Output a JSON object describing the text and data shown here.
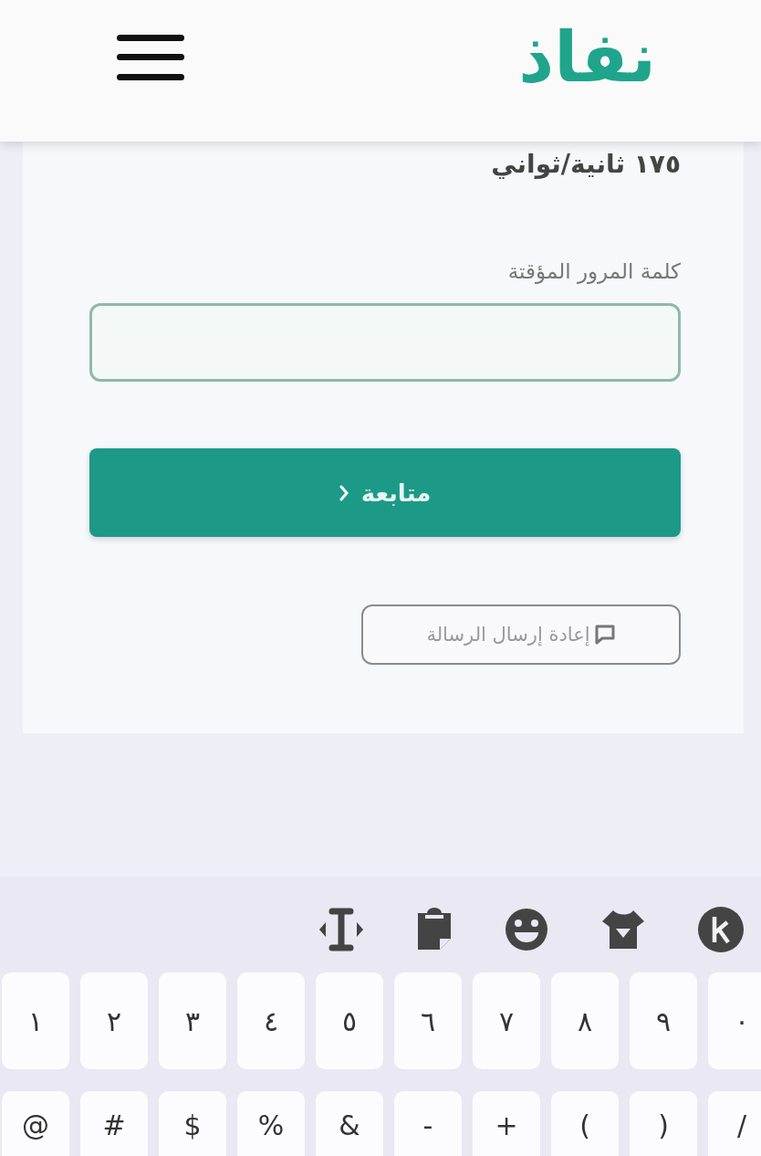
{
  "header": {
    "logo": "نفاذ"
  },
  "form": {
    "timer": "١٧٥ ثانية/ثواني",
    "field_label": "كلمة المرور المؤقتة",
    "continue_button": "متابعة",
    "resend_button": "إعادة إرسال الرسالة"
  },
  "keyboard": {
    "rows": [
      [
        "٠",
        "٩",
        "٨",
        "٧",
        "٦",
        "٥",
        "٤",
        "٣",
        "٢",
        "١"
      ],
      [
        "/",
        ")",
        "(",
        "+",
        "-",
        "&",
        "%",
        "$",
        "#",
        "@"
      ]
    ]
  }
}
